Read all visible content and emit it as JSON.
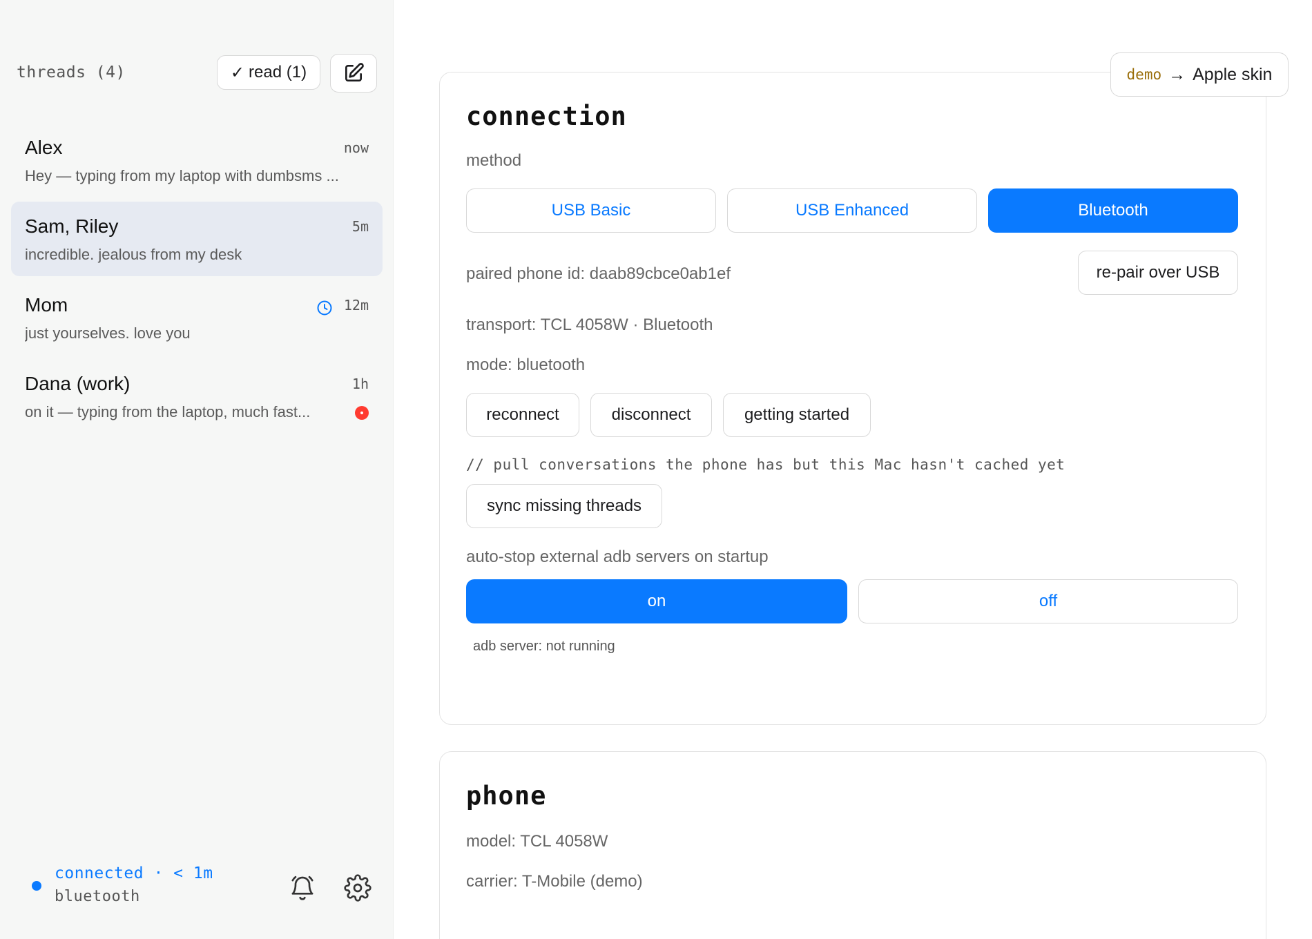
{
  "sidebar": {
    "title": "threads (4)",
    "read_button": {
      "check": "✓",
      "label": "read (1)"
    },
    "threads": [
      {
        "name": "Alex",
        "time": "now",
        "preview": "Hey — typing from my laptop with dumbsms ..."
      },
      {
        "name": "Sam, Riley",
        "time": "5m",
        "preview": "incredible. jealous from my desk"
      },
      {
        "name": "Mom",
        "time": "12m",
        "preview": "just yourselves. love you"
      },
      {
        "name": "Dana (work)",
        "time": "1h",
        "preview": "on it — typing from the laptop, much fast..."
      }
    ],
    "footer": {
      "status": "connected · < 1m",
      "transport": "bluetooth"
    }
  },
  "skin": {
    "demo": "demo",
    "arrow": "→",
    "label": "Apple skin"
  },
  "connection": {
    "title": "connection",
    "method_label": "method",
    "methods": [
      "USB Basic",
      "USB Enhanced",
      "Bluetooth"
    ],
    "paired_id": "paired phone id: daab89cbce0ab1ef",
    "repair_button": "re-pair over USB",
    "transport": "transport: TCL 4058W · Bluetooth",
    "mode": "mode: bluetooth",
    "actions": [
      "reconnect",
      "disconnect",
      "getting started"
    ],
    "sync_comment": "// pull conversations the phone has but this Mac hasn't cached yet",
    "sync_button": "sync missing threads",
    "autostop_label": "auto-stop external adb servers on startup",
    "autostop_on": "on",
    "autostop_off": "off",
    "adb_status": "adb server: not running"
  },
  "phone": {
    "title": "phone",
    "model": "model: TCL 4058W",
    "carrier": "carrier: T-Mobile (demo)"
  },
  "colors": {
    "accent": "#0a7aff",
    "unread": "#ff3b30",
    "selected_row": "#e6eaf2"
  }
}
